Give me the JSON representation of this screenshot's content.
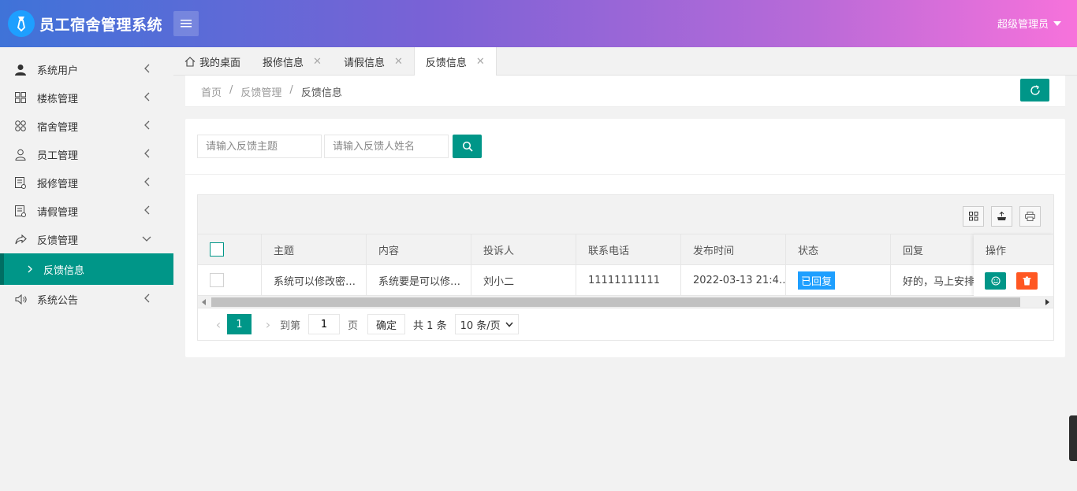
{
  "header": {
    "title": "员工宿舍管理系统",
    "user": "超级管理员",
    "logo_icon": "tie-logo-icon",
    "menu_icon": "hamburger-icon"
  },
  "sidebar": {
    "items": [
      {
        "label": "系统用户",
        "icon": "user-icon"
      },
      {
        "label": "楼栋管理",
        "icon": "grid-icon"
      },
      {
        "label": "宿舍管理",
        "icon": "clover-icon"
      },
      {
        "label": "员工管理",
        "icon": "person-outline-icon"
      },
      {
        "label": "报修管理",
        "icon": "form-icon"
      },
      {
        "label": "请假管理",
        "icon": "form-icon"
      },
      {
        "label": "反馈管理",
        "icon": "share-arrow-icon"
      },
      {
        "label": "系统公告",
        "icon": "speaker-icon"
      }
    ],
    "active_sub": "反馈信息"
  },
  "tabs": [
    {
      "label": "我的桌面"
    },
    {
      "label": "报修信息"
    },
    {
      "label": "请假信息"
    },
    {
      "label": "反馈信息"
    }
  ],
  "breadcrumb": {
    "home": "首页",
    "section": "反馈管理",
    "current": "反馈信息",
    "separator": "/"
  },
  "search": {
    "subject_placeholder": "请输入反馈主题",
    "name_placeholder": "请输入反馈人姓名"
  },
  "table": {
    "columns": [
      "主题",
      "内容",
      "投诉人",
      "联系电话",
      "发布时间",
      "状态",
      "回复",
      "操作"
    ],
    "rows": [
      {
        "subject": "系统可以修改密…",
        "content": "系统要是可以修…",
        "complainant": "刘小二",
        "phone": "11111111111",
        "time": "2022-03-13 21:4…",
        "status": "已回复",
        "reply": "好的，马上安排。"
      }
    ]
  },
  "pagination": {
    "current_page": "1",
    "goto_label": "到第",
    "goto_value": "1",
    "page_unit": "页",
    "confirm": "确定",
    "total": "共 1 条",
    "page_size": "10 条/页"
  },
  "colors": {
    "primary": "#009688",
    "blue": "#1e9fff",
    "danger": "#ff5722"
  }
}
